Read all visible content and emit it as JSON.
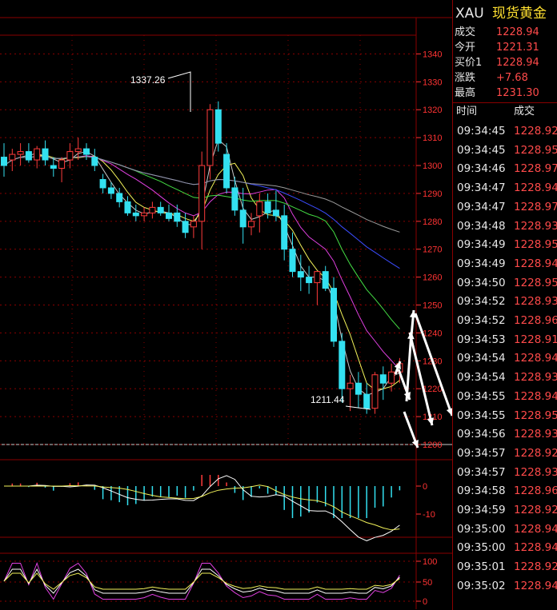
{
  "quote": {
    "symbol": "XAU",
    "name": "现货黄金",
    "rows": [
      {
        "label": "成交",
        "value": "1228.94"
      },
      {
        "label": "今开",
        "value": "1221.31"
      },
      {
        "label": "买价1",
        "value": "1228.94"
      },
      {
        "label": "涨跌",
        "value": "+7.68"
      },
      {
        "label": "最高",
        "value": "1231.30"
      }
    ]
  },
  "ticks": {
    "header_time": "时间",
    "header_price": "成交",
    "rows": [
      {
        "time": "09:34:45",
        "price": "1228.92"
      },
      {
        "time": "09:34:45",
        "price": "1228.95"
      },
      {
        "time": "09:34:46",
        "price": "1228.97"
      },
      {
        "time": "09:34:47",
        "price": "1228.94"
      },
      {
        "time": "09:34:47",
        "price": "1228.97"
      },
      {
        "time": "09:34:48",
        "price": "1228.93"
      },
      {
        "time": "09:34:49",
        "price": "1228.95"
      },
      {
        "time": "09:34:49",
        "price": "1228.94"
      },
      {
        "time": "09:34:50",
        "price": "1228.95"
      },
      {
        "time": "09:34:52",
        "price": "1228.93"
      },
      {
        "time": "09:34:52",
        "price": "1228.96"
      },
      {
        "time": "09:34:53",
        "price": "1228.91"
      },
      {
        "time": "09:34:54",
        "price": "1228.94"
      },
      {
        "time": "09:34:54",
        "price": "1228.93"
      },
      {
        "time": "09:34:55",
        "price": "1228.94"
      },
      {
        "time": "09:34:55",
        "price": "1228.95"
      },
      {
        "time": "09:34:56",
        "price": "1228.93"
      },
      {
        "time": "09:34:57",
        "price": "1228.92"
      },
      {
        "time": "09:34:57",
        "price": "1228.93"
      },
      {
        "time": "09:34:58",
        "price": "1228.96"
      },
      {
        "time": "09:34:59",
        "price": "1228.92"
      },
      {
        "time": "09:35:00",
        "price": "1228.94"
      },
      {
        "time": "09:35:00",
        "price": "1228.94"
      },
      {
        "time": "09:35:01",
        "price": "1228.92"
      },
      {
        "time": "09:35:02",
        "price": "1228.94"
      }
    ]
  },
  "colors": {
    "up": "#ff3b3b",
    "down": "#33e0f0",
    "grid": "#8a0000",
    "axis_text": "#ff3333",
    "ma_white": "#c8c8c8",
    "ma_yellow": "#f2f25a",
    "ma_magenta": "#e040e0",
    "ma_green": "#44dd44",
    "ma_blue": "#3b4cff",
    "ma_gray": "#9a9a9a"
  },
  "chart_data": {
    "type": "candlestick",
    "ylim": [
      1200,
      1345
    ],
    "y_ticks": [
      "1340",
      "1330",
      "1320",
      "1310",
      "1300",
      "1290",
      "1280",
      "1270",
      "1260",
      "1250",
      "1240",
      "1230",
      "1220",
      "1210",
      "1200"
    ],
    "high_label": "1337.26",
    "low_label": "1211.44",
    "candles": [
      [
        1303,
        1308,
        1296,
        1300
      ],
      [
        1302,
        1306,
        1298,
        1304
      ],
      [
        1304,
        1308,
        1300,
        1305
      ],
      [
        1305,
        1308,
        1301,
        1302
      ],
      [
        1302,
        1307,
        1299,
        1306
      ],
      [
        1306,
        1309,
        1300,
        1302
      ],
      [
        1300,
        1303,
        1296,
        1299
      ],
      [
        1299,
        1303,
        1294,
        1302
      ],
      [
        1302,
        1308,
        1299,
        1305
      ],
      [
        1305,
        1310,
        1302,
        1306
      ],
      [
        1306,
        1308,
        1302,
        1304
      ],
      [
        1303,
        1306,
        1298,
        1300
      ],
      [
        1295,
        1297,
        1290,
        1292
      ],
      [
        1292,
        1294,
        1288,
        1290
      ],
      [
        1290,
        1292,
        1285,
        1287
      ],
      [
        1287,
        1289,
        1282,
        1283
      ],
      [
        1283,
        1286,
        1280,
        1282
      ],
      [
        1282,
        1285,
        1280,
        1283
      ],
      [
        1283,
        1287,
        1281,
        1285
      ],
      [
        1285,
        1287,
        1282,
        1283
      ],
      [
        1283,
        1286,
        1280,
        1281
      ],
      [
        1283,
        1286,
        1278,
        1280
      ],
      [
        1280,
        1283,
        1274,
        1276
      ],
      [
        1278,
        1282,
        1274,
        1280
      ],
      [
        1280,
        1305,
        1270,
        1300
      ],
      [
        1300,
        1322,
        1295,
        1320
      ],
      [
        1320,
        1323,
        1305,
        1308
      ],
      [
        1304,
        1308,
        1290,
        1292
      ],
      [
        1292,
        1296,
        1282,
        1284
      ],
      [
        1284,
        1292,
        1272,
        1278
      ],
      [
        1278,
        1283,
        1275,
        1280
      ],
      [
        1282,
        1290,
        1276,
        1287
      ],
      [
        1287,
        1290,
        1281,
        1283
      ],
      [
        1284,
        1291,
        1280,
        1282
      ],
      [
        1282,
        1286,
        1266,
        1270
      ],
      [
        1270,
        1276,
        1260,
        1262
      ],
      [
        1262,
        1268,
        1255,
        1260
      ],
      [
        1260,
        1264,
        1254,
        1258
      ],
      [
        1258,
        1262,
        1250,
        1262
      ],
      [
        1262,
        1264,
        1255,
        1256
      ],
      [
        1256,
        1260,
        1235,
        1237
      ],
      [
        1237,
        1240,
        1215,
        1220
      ],
      [
        1220,
        1225,
        1212,
        1222
      ],
      [
        1222,
        1226,
        1213,
        1218
      ],
      [
        1218,
        1222,
        1211,
        1213
      ],
      [
        1213,
        1226,
        1211,
        1225
      ],
      [
        1225,
        1228,
        1216,
        1222
      ],
      [
        1222,
        1229,
        1219,
        1226
      ],
      [
        1226,
        1231,
        1222,
        1229
      ]
    ],
    "macd": {
      "y_ticks": [
        "0",
        "-10"
      ]
    },
    "kdj": {
      "y_ticks": [
        "100",
        "50",
        "0"
      ]
    }
  }
}
